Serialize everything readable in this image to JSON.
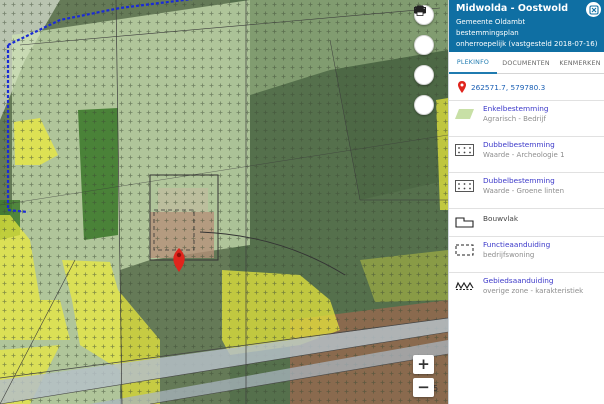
{
  "header": {
    "title": "Midwolda - Oostwold",
    "municipality": "Gemeente Oldambt",
    "plan_type": "bestemmingsplan",
    "status": "onherroepelijk (vastgesteld 2018-07-16)"
  },
  "tabs": [
    {
      "label": "PLEKINFO",
      "active": true
    },
    {
      "label": "DOCUMENTEN",
      "active": false
    },
    {
      "label": "KENMERKEN",
      "active": false
    }
  ],
  "coordinates": "262571.7, 579780.3",
  "legend": {
    "enkel": {
      "title": "Enkelbestemming",
      "value": "Agrarisch - Bedrijf"
    },
    "dubbel1": {
      "title": "Dubbelbestemming",
      "value": "Waarde - Archeologie 1"
    },
    "dubbel2": {
      "title": "Dubbelbestemming",
      "value": "Waarde - Groene linten"
    },
    "bouwvlak": {
      "title": "Bouwvlak"
    },
    "functie": {
      "title": "Functieaanduiding",
      "value": "bedrijfswoning"
    },
    "gebied": {
      "title": "Gebiedsaanduiding",
      "value": "overige zone - karakteristiek"
    }
  },
  "map_controls": {
    "zoom_in": "+",
    "zoom_out": "−",
    "tools": [
      "layers-icon",
      "measure-icon",
      "list-icon",
      "print-icon"
    ]
  },
  "colors": {
    "header": "#0f6fa3",
    "link": "#3b38c9",
    "accent": "#1f7bb0",
    "pin": "#e0241c",
    "agrarisch": "#c8e0a6",
    "yellow_zone": "#ecea3c",
    "boundary": "#1a2bd6"
  }
}
